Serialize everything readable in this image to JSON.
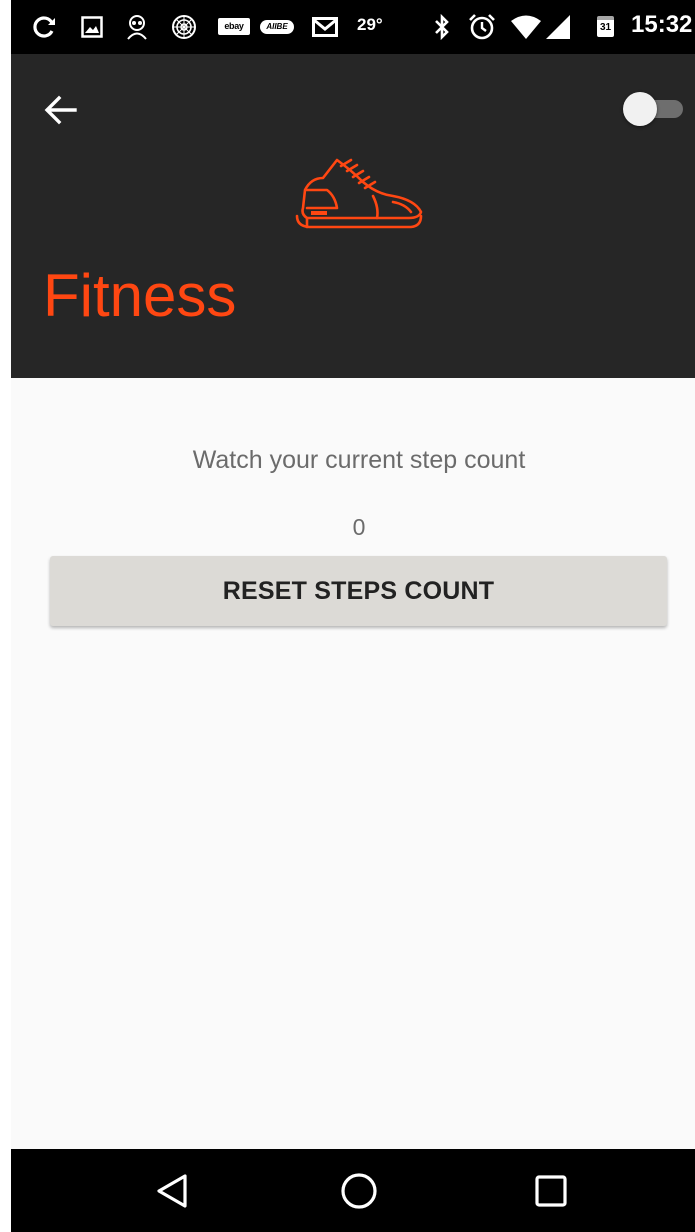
{
  "status_bar": {
    "ebay_label": "ebay",
    "aiibe_label": "AIIBE",
    "temperature": "29°",
    "calendar_day": "31",
    "time": "15:32"
  },
  "header": {
    "title": "Fitness",
    "accent_color": "#ff4712",
    "background_color": "#262626",
    "toggle_on": false
  },
  "content": {
    "subtitle": "Watch your current step count",
    "step_count": "0",
    "reset_button_label": "RESET STEPS COUNT"
  },
  "icons": {
    "status": [
      "sync-icon",
      "image-icon",
      "spy-icon",
      "radar-icon",
      "ebay-icon",
      "aiibe-icon",
      "gmail-icon",
      "bluetooth-icon",
      "alarm-icon",
      "wifi-icon",
      "signal-icon",
      "calendar-icon"
    ],
    "header": [
      "back-arrow-icon",
      "shoe-icon"
    ],
    "nav": [
      "back-triangle-icon",
      "home-circle-icon",
      "recents-square-icon"
    ]
  }
}
